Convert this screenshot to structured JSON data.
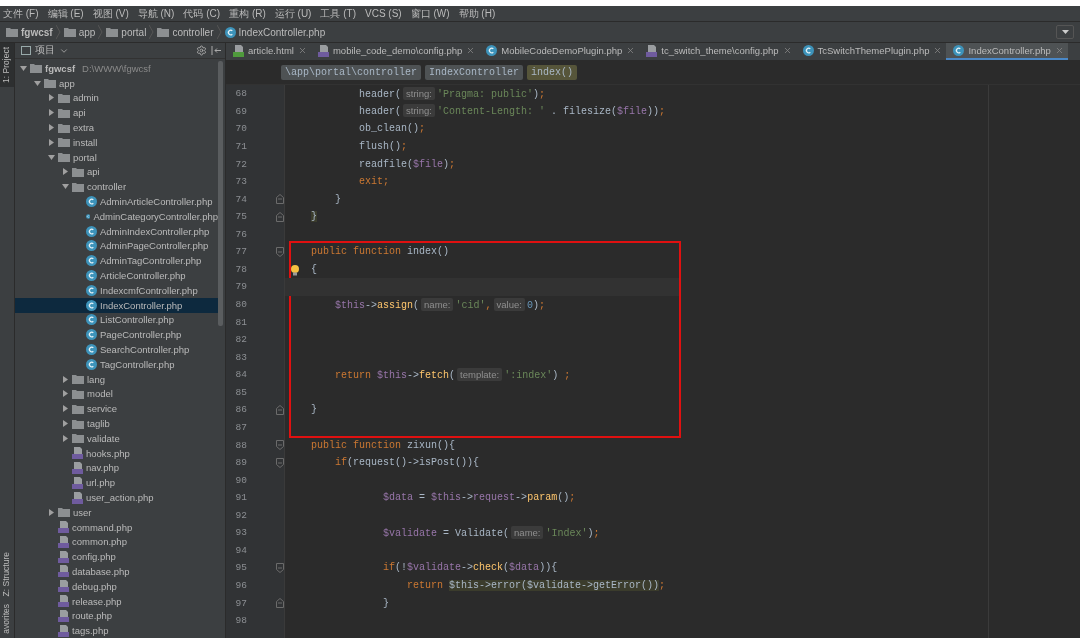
{
  "menu": [
    "文件 (F)",
    "编辑 (E)",
    "视图 (V)",
    "导航 (N)",
    "代码 (C)",
    "重构 (R)",
    "运行 (U)",
    "工具 (T)",
    "VCS (S)",
    "窗口 (W)",
    "帮助 (H)"
  ],
  "nav_bar": [
    {
      "label": "fgwcsf",
      "kind": "root"
    },
    {
      "label": "app",
      "kind": "folder"
    },
    {
      "label": "portal",
      "kind": "folder"
    },
    {
      "label": "controller",
      "kind": "folder"
    },
    {
      "label": "IndexController.php",
      "kind": "class"
    }
  ],
  "side_strip": [
    {
      "label": "1: Project",
      "selected": true
    },
    {
      "label": "Z: Structure",
      "selected": false
    },
    {
      "label": "avorites",
      "selected": false
    }
  ],
  "project_panel": {
    "title": "项目",
    "tree": [
      {
        "label": "fgwcsf",
        "path": "D:\\WWW\\fgwcsf",
        "kind": "root",
        "expanded": true,
        "selected": false,
        "children": [
          {
            "label": "app",
            "kind": "folder",
            "expanded": true,
            "selected": false,
            "children": [
              {
                "label": "admin",
                "kind": "folder",
                "expanded": false,
                "selected": false
              },
              {
                "label": "api",
                "kind": "folder",
                "expanded": false,
                "selected": false
              },
              {
                "label": "extra",
                "kind": "folder",
                "expanded": false,
                "selected": false
              },
              {
                "label": "install",
                "kind": "folder",
                "expanded": false,
                "selected": false
              },
              {
                "label": "portal",
                "kind": "folder",
                "expanded": true,
                "selected": false,
                "children": [
                  {
                    "label": "api",
                    "kind": "folder",
                    "expanded": false,
                    "selected": false
                  },
                  {
                    "label": "controller",
                    "kind": "folder",
                    "expanded": true,
                    "selected": false,
                    "children": [
                      {
                        "label": "AdminArticleController.php",
                        "kind": "class",
                        "selected": false
                      },
                      {
                        "label": "AdminCategoryController.php",
                        "kind": "class",
                        "selected": false
                      },
                      {
                        "label": "AdminIndexController.php",
                        "kind": "class",
                        "selected": false
                      },
                      {
                        "label": "AdminPageController.php",
                        "kind": "class",
                        "selected": false
                      },
                      {
                        "label": "AdminTagController.php",
                        "kind": "class",
                        "selected": false
                      },
                      {
                        "label": "ArticleController.php",
                        "kind": "class",
                        "selected": false
                      },
                      {
                        "label": "IndexcmfController.php",
                        "kind": "class",
                        "selected": false
                      },
                      {
                        "label": "IndexController.php",
                        "kind": "class",
                        "selected": true
                      },
                      {
                        "label": "ListController.php",
                        "kind": "class",
                        "selected": false
                      },
                      {
                        "label": "PageController.php",
                        "kind": "class",
                        "selected": false
                      },
                      {
                        "label": "SearchController.php",
                        "kind": "class",
                        "selected": false
                      },
                      {
                        "label": "TagController.php",
                        "kind": "class",
                        "selected": false
                      }
                    ]
                  },
                  {
                    "label": "lang",
                    "kind": "folder",
                    "expanded": false,
                    "selected": false
                  },
                  {
                    "label": "model",
                    "kind": "folder",
                    "expanded": false,
                    "selected": false
                  },
                  {
                    "label": "service",
                    "kind": "folder",
                    "expanded": false,
                    "selected": false
                  },
                  {
                    "label": "taglib",
                    "kind": "folder",
                    "expanded": false,
                    "selected": false
                  },
                  {
                    "label": "validate",
                    "kind": "folder",
                    "expanded": false,
                    "selected": false
                  },
                  {
                    "label": "hooks.php",
                    "kind": "php",
                    "selected": false
                  },
                  {
                    "label": "nav.php",
                    "kind": "php",
                    "selected": false
                  },
                  {
                    "label": "url.php",
                    "kind": "php",
                    "selected": false
                  },
                  {
                    "label": "user_action.php",
                    "kind": "php",
                    "selected": false
                  }
                ]
              },
              {
                "label": "user",
                "kind": "folder",
                "expanded": false,
                "selected": false
              },
              {
                "label": "command.php",
                "kind": "php",
                "selected": false
              },
              {
                "label": "common.php",
                "kind": "php",
                "selected": false
              },
              {
                "label": "config.php",
                "kind": "php",
                "selected": false
              },
              {
                "label": "database.php",
                "kind": "php",
                "selected": false
              },
              {
                "label": "debug.php",
                "kind": "php",
                "selected": false
              },
              {
                "label": "release.php",
                "kind": "php",
                "selected": false
              },
              {
                "label": "route.php",
                "kind": "php",
                "selected": false
              },
              {
                "label": "tags.php",
                "kind": "php",
                "selected": false
              }
            ]
          }
        ]
      }
    ]
  },
  "editor_tabs": [
    {
      "label": "article.html",
      "kind": "html",
      "selected": false
    },
    {
      "label": "mobile_code_demo\\config.php",
      "kind": "php",
      "selected": false
    },
    {
      "label": "MobileCodeDemoPlugin.php",
      "kind": "class",
      "selected": false
    },
    {
      "label": "tc_switch_theme\\config.php",
      "kind": "php",
      "selected": false
    },
    {
      "label": "TcSwitchThemePlugin.php",
      "kind": "class",
      "selected": false
    },
    {
      "label": "IndexController.php",
      "kind": "class",
      "selected": true
    }
  ],
  "code_breadcrumbs": [
    {
      "label": "\\app\\portal\\controller",
      "selected": false
    },
    {
      "label": "IndexController",
      "selected": false
    },
    {
      "label": "index()",
      "selected": true
    }
  ],
  "code": [
    {
      "number": "68",
      "tokens": [
        {
          "kind": "plain",
          "text": "            header("
        },
        {
          "kind": "hint",
          "text": "string:"
        },
        {
          "kind": "str",
          "text": "'Pragma: public'"
        },
        {
          "kind": "plain",
          "text": ")"
        },
        {
          "kind": "punct",
          "text": ";"
        }
      ]
    },
    {
      "number": "69",
      "tokens": [
        {
          "kind": "plain",
          "text": "            header("
        },
        {
          "kind": "hint",
          "text": "string:"
        },
        {
          "kind": "str",
          "text": "'Content-Length: '"
        },
        {
          "kind": "plain",
          "text": " . filesize("
        },
        {
          "kind": "var",
          "text": "$file"
        },
        {
          "kind": "plain",
          "text": "))"
        },
        {
          "kind": "punct",
          "text": ";"
        }
      ]
    },
    {
      "number": "70",
      "tokens": [
        {
          "kind": "plain",
          "text": "            ob_clean()"
        },
        {
          "kind": "punct",
          "text": ";"
        }
      ]
    },
    {
      "number": "71",
      "tokens": [
        {
          "kind": "plain",
          "text": "            flush()"
        },
        {
          "kind": "punct",
          "text": ";"
        }
      ]
    },
    {
      "number": "72",
      "tokens": [
        {
          "kind": "plain",
          "text": "            readfile("
        },
        {
          "kind": "var",
          "text": "$file"
        },
        {
          "kind": "plain",
          "text": ")"
        },
        {
          "kind": "punct",
          "text": ";"
        }
      ]
    },
    {
      "number": "73",
      "tokens": [
        {
          "kind": "kw",
          "text": "            exit"
        },
        {
          "kind": "punct",
          "text": ";"
        }
      ]
    },
    {
      "number": "74",
      "fold": {
        "kind": "end"
      },
      "tokens": [
        {
          "kind": "plain",
          "text": "        }"
        }
      ]
    },
    {
      "number": "75",
      "fold": {
        "kind": "end"
      },
      "tokens": [
        {
          "kind": "match",
          "text": "    }"
        }
      ]
    },
    {
      "number": "76"
    },
    {
      "kind": "annotation_box",
      "lines": [
        {
          "number": "77",
          "fold": {
            "kind": "start"
          },
          "tokens": [
            {
              "kind": "kw",
              "text": "    public function "
            },
            {
              "kind": "plain",
              "text": "index()"
            }
          ]
        },
        {
          "number": "78",
          "bulb": true,
          "tokens": [
            {
              "kind": "plain",
              "text": "    {"
            }
          ]
        },
        {
          "number": "79",
          "current": true
        },
        {
          "number": "80",
          "tokens": [
            {
              "kind": "var",
              "text": "        $this"
            },
            {
              "kind": "plain",
              "text": "->"
            },
            {
              "kind": "fn",
              "text": "assign"
            },
            {
              "kind": "plain",
              "text": "("
            },
            {
              "kind": "hint",
              "text": "name:"
            },
            {
              "kind": "str",
              "text": "'cid'"
            },
            {
              "kind": "punct",
              "text": ","
            },
            {
              "kind": "hint",
              "text": "value:"
            },
            {
              "kind": "num",
              "text": "0"
            },
            {
              "kind": "plain",
              "text": ")"
            },
            {
              "kind": "punct",
              "text": ";"
            }
          ]
        },
        {
          "number": "81"
        },
        {
          "number": "82"
        },
        {
          "number": "83"
        },
        {
          "number": "84",
          "tokens": [
            {
              "kind": "kw",
              "text": "        return "
            },
            {
              "kind": "var",
              "text": "$this"
            },
            {
              "kind": "plain",
              "text": "->"
            },
            {
              "kind": "fn",
              "text": "fetch"
            },
            {
              "kind": "plain",
              "text": "("
            },
            {
              "kind": "hint",
              "text": "template:"
            },
            {
              "kind": "str",
              "text": "':index'"
            },
            {
              "kind": "plain",
              "text": ") "
            },
            {
              "kind": "punct",
              "text": ";"
            }
          ]
        },
        {
          "number": "85"
        },
        {
          "number": "86",
          "fold": {
            "kind": "end"
          },
          "tokens": [
            {
              "kind": "plain",
              "text": "    }"
            }
          ]
        },
        {
          "number": "87"
        }
      ]
    },
    {
      "number": "88",
      "fold": {
        "kind": "start"
      },
      "tokens": [
        {
          "kind": "kw",
          "text": "    public function "
        },
        {
          "kind": "plain",
          "text": "zixun(){"
        }
      ]
    },
    {
      "number": "89",
      "fold": {
        "kind": "start"
      },
      "tokens": [
        {
          "kind": "kw",
          "text": "        if"
        },
        {
          "kind": "plain",
          "text": "(request()->isPost()){"
        }
      ]
    },
    {
      "number": "90"
    },
    {
      "number": "91",
      "tokens": [
        {
          "kind": "var",
          "text": "                $data"
        },
        {
          "kind": "plain",
          "text": " = "
        },
        {
          "kind": "var",
          "text": "$this"
        },
        {
          "kind": "plain",
          "text": "->"
        },
        {
          "kind": "var",
          "text": "request"
        },
        {
          "kind": "plain",
          "text": "->"
        },
        {
          "kind": "fn",
          "text": "param"
        },
        {
          "kind": "plain",
          "text": "()"
        },
        {
          "kind": "punct",
          "text": ";"
        }
      ]
    },
    {
      "number": "92"
    },
    {
      "number": "93",
      "tokens": [
        {
          "kind": "var",
          "text": "                $validate"
        },
        {
          "kind": "plain",
          "text": " = Validate("
        },
        {
          "kind": "hint",
          "text": "name:"
        },
        {
          "kind": "str",
          "text": "'Index'"
        },
        {
          "kind": "plain",
          "text": ")"
        },
        {
          "kind": "punct",
          "text": ";"
        }
      ]
    },
    {
      "number": "94"
    },
    {
      "number": "95",
      "fold": {
        "kind": "start"
      },
      "tokens": [
        {
          "kind": "kw",
          "text": "                if"
        },
        {
          "kind": "plain",
          "text": "(!"
        },
        {
          "kind": "var",
          "text": "$validate"
        },
        {
          "kind": "plain",
          "text": "->"
        },
        {
          "kind": "fn",
          "text": "check"
        },
        {
          "kind": "plain",
          "text": "("
        },
        {
          "kind": "var",
          "text": "$data"
        },
        {
          "kind": "plain",
          "text": ")){"
        }
      ]
    },
    {
      "number": "96",
      "tokens": [
        {
          "kind": "kw",
          "text": "                    return "
        },
        {
          "kind": "match",
          "text": "$this->error($validate->getError())"
        },
        {
          "kind": "punct",
          "text": ";"
        }
      ]
    },
    {
      "number": "97",
      "fold": {
        "kind": "end"
      },
      "tokens": [
        {
          "kind": "plain",
          "text": "                }"
        }
      ]
    },
    {
      "number": "98"
    }
  ]
}
